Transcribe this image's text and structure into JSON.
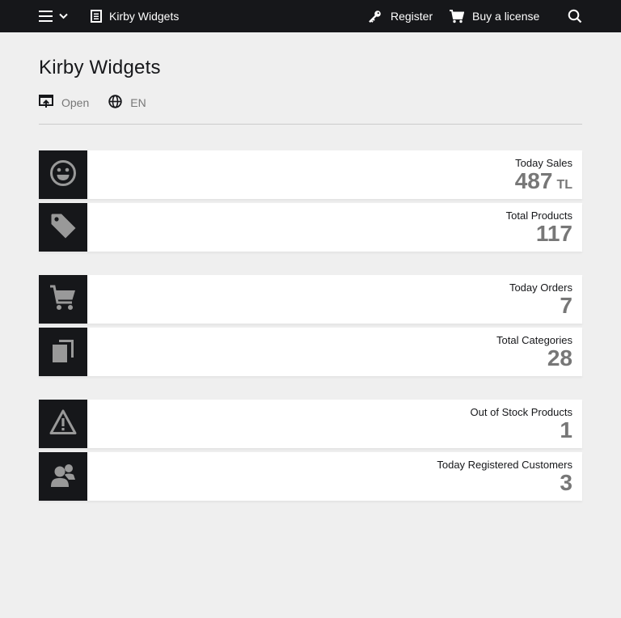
{
  "topbar": {
    "site_name": "Kirby Widgets",
    "register_label": "Register",
    "license_label": "Buy a license"
  },
  "header": {
    "title": "Kirby Widgets",
    "open_label": "Open",
    "language_label": "EN"
  },
  "widgets": [
    {
      "label": "Today Sales",
      "value": "487",
      "unit": "TL",
      "icon": "smile-icon"
    },
    {
      "label": "Total Products",
      "value": "117",
      "icon": "tag-icon"
    },
    {
      "label": "Today Orders",
      "value": "7",
      "icon": "cart-icon"
    },
    {
      "label": "Total Categories",
      "value": "28",
      "icon": "copy-icon"
    },
    {
      "label": "Out of Stock Products",
      "value": "1",
      "icon": "warning-icon"
    },
    {
      "label": "Today Registered Customers",
      "value": "3",
      "icon": "users-icon"
    }
  ],
  "colors": {
    "topbar": "#16171a",
    "background": "#efefef",
    "value_text": "#777777",
    "icon_fill": "#999999"
  }
}
